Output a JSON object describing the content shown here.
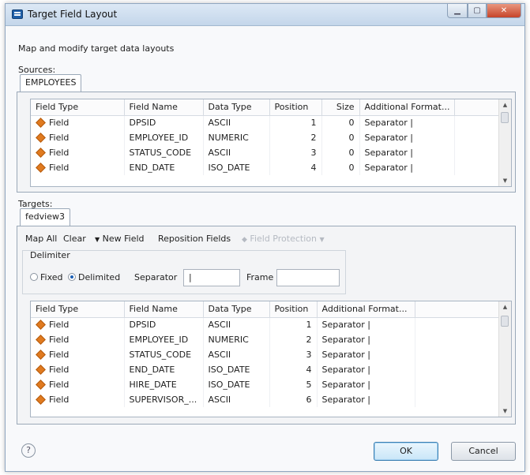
{
  "window": {
    "title": "Target Field Layout"
  },
  "subtitle": "Map and modify target data layouts",
  "sources": {
    "label": "Sources:",
    "tab": "EMPLOYEES",
    "columns": [
      "Field Type",
      "Field Name",
      "Data Type",
      "Position",
      "Size",
      "Additional Format..."
    ],
    "rows": [
      [
        "Field",
        "DPSID",
        "ASCII",
        "1",
        "0",
        "Separator |"
      ],
      [
        "Field",
        "EMPLOYEE_ID",
        "NUMERIC",
        "2",
        "0",
        "Separator |"
      ],
      [
        "Field",
        "STATUS_CODE",
        "ASCII",
        "3",
        "0",
        "Separator |"
      ],
      [
        "Field",
        "END_DATE",
        "ISO_DATE",
        "4",
        "0",
        "Separator |"
      ]
    ]
  },
  "targets": {
    "label": "Targets:",
    "tab": "fedview3",
    "toolbar": {
      "map_all": "Map All",
      "clear": "Clear",
      "new_field": "New Field",
      "reposition_fields": "Reposition Fields",
      "field_protection": "Field Protection"
    },
    "delimiter": {
      "label": "Delimiter",
      "fixed": "Fixed",
      "delimited": "Delimited",
      "separator_label": "Separator",
      "separator_value": "|",
      "frame_label": "Frame",
      "frame_value": ""
    },
    "columns": [
      "Field Type",
      "Field Name",
      "Data Type",
      "Position",
      "Additional Format..."
    ],
    "rows": [
      [
        "Field",
        "DPSID",
        "ASCII",
        "1",
        "Separator |"
      ],
      [
        "Field",
        "EMPLOYEE_ID",
        "NUMERIC",
        "2",
        "Separator |"
      ],
      [
        "Field",
        "STATUS_CODE",
        "ASCII",
        "3",
        "Separator |"
      ],
      [
        "Field",
        "END_DATE",
        "ISO_DATE",
        "4",
        "Separator |"
      ],
      [
        "Field",
        "HIRE_DATE",
        "ISO_DATE",
        "5",
        "Separator |"
      ],
      [
        "Field",
        "SUPERVISOR_...",
        "ASCII",
        "6",
        "Separator |"
      ]
    ]
  },
  "buttons": {
    "ok": "OK",
    "cancel": "Cancel",
    "help": "?"
  },
  "icons": {
    "field": "field-icon",
    "new_field": "dropdown-arrow-icon",
    "field_protection": "shield-icon"
  }
}
